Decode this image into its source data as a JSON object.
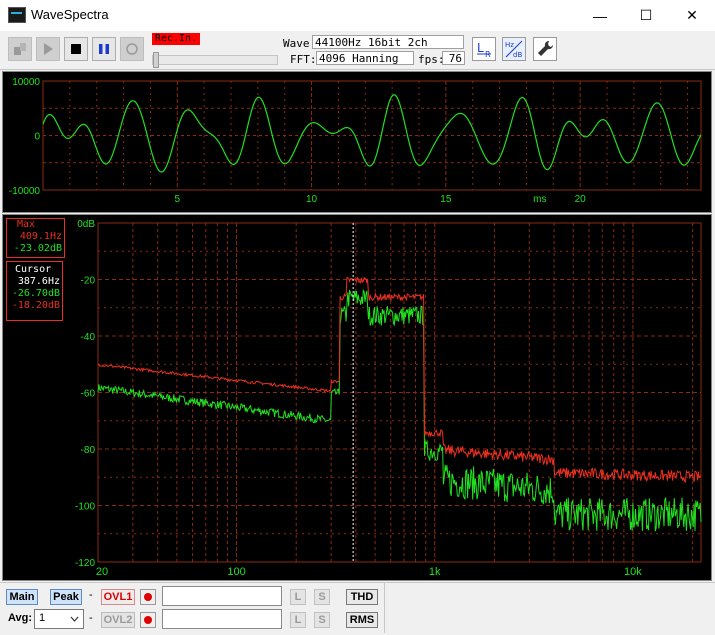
{
  "window": {
    "title": "WaveSpectra",
    "minimize": "—",
    "maximize": "☐",
    "close": "✕"
  },
  "toolbar": {
    "rec_indicator": "Rec.In.",
    "wave_label": "Wave:",
    "wave_value": "44100Hz 16bit 2ch",
    "fft_label": "FFT:",
    "fft_value": "4096 Hanning",
    "fps_label": "fps:",
    "fps_value": "76",
    "icons": [
      "settings-icon",
      "play-icon",
      "stop-icon",
      "pause-icon",
      "record-icon",
      "channel-lr-icon",
      "hz-db-icon",
      "wrench-icon"
    ]
  },
  "wave_chart": {
    "y_ticks": [
      "10000",
      "0",
      "-10000"
    ],
    "x_ticks": [
      "5",
      "10",
      "15",
      "20"
    ],
    "x_unit": "ms",
    "ylim": [
      -10000,
      10000
    ],
    "xlim": [
      0,
      24.5
    ]
  },
  "spectrum_chart": {
    "y_ticks": [
      "0dB",
      "-20",
      "-40",
      "-60",
      "-80",
      "-100",
      "-120"
    ],
    "x_ticks": [
      "20",
      "100",
      "1k",
      "10k"
    ],
    "ylim": [
      -120,
      0
    ],
    "xlim": [
      20,
      22050
    ],
    "x_scale": "log",
    "max_box": {
      "label": "Max",
      "freq": "409.1Hz",
      "db": "-23.02dB"
    },
    "cursor_box": {
      "label": "Cursor",
      "freq": "387.6Hz",
      "db_green": "-26.70dB",
      "db_red": "-18.20dB"
    },
    "cursor_freq": 387.6,
    "colors": {
      "red": "#e83020",
      "green": "#20e020",
      "grid": "#8a2a10"
    }
  },
  "bottom": {
    "main": "Main",
    "peak": "Peak",
    "dash1": "-",
    "dash2": "-",
    "ovl1": "OVL1",
    "ovl2": "OVL2",
    "avg_label": "Avg:",
    "avg_value": "1",
    "l1": "L",
    "s1": "S",
    "l2": "L",
    "s2": "S",
    "thd": "THD",
    "rms": "RMS"
  }
}
